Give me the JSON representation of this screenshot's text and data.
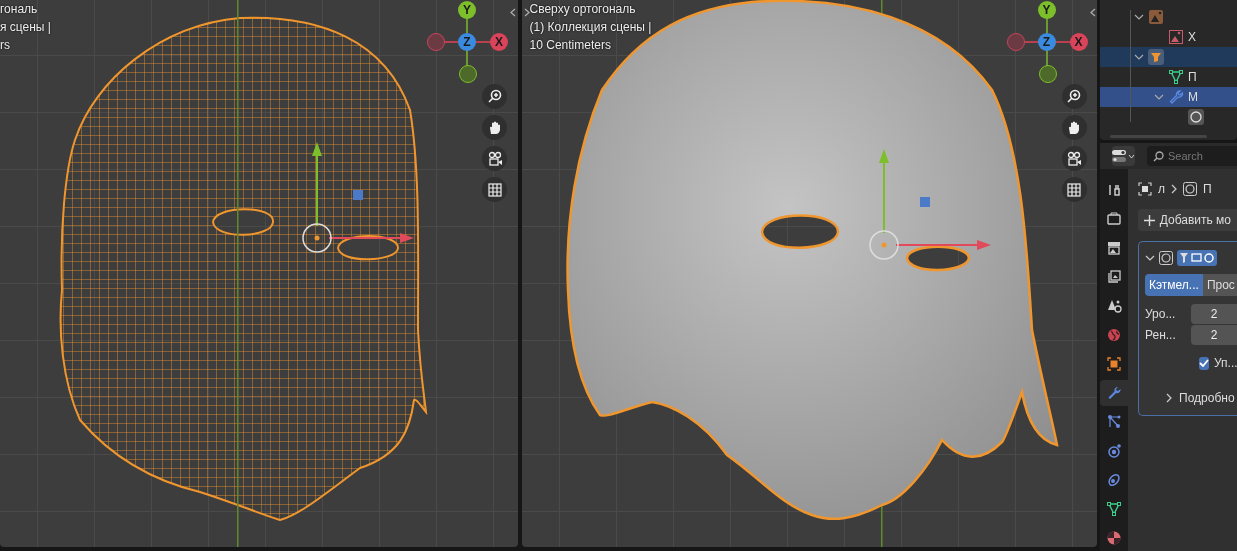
{
  "viewports": [
    {
      "kind": "wireframe",
      "header_lines": [
        "гональ",
        "я сцены |",
        "rs"
      ],
      "gizmo_labels": [
        "Y",
        "Z",
        "X"
      ]
    },
    {
      "kind": "solid",
      "header_lines": [
        "Сверху ортогональ",
        "(1) Коллекция сцены |",
        "10 Centimeters"
      ],
      "gizmo_labels": [
        "Y",
        "Z",
        "X"
      ]
    }
  ],
  "outliner": {
    "items": [
      {
        "kind": "empty",
        "expanded": true,
        "selected": false,
        "active": false,
        "children": [
          {
            "kind": "image",
            "label": "Х",
            "selected": false,
            "active": false
          }
        ]
      },
      {
        "kind": "mesh_object",
        "expanded": true,
        "selected": true,
        "active": false,
        "children": [
          {
            "kind": "mesh_data",
            "label": "П",
            "selected": false,
            "active": false
          },
          {
            "kind": "modifiers",
            "label": "М",
            "expanded": true,
            "selected": true,
            "active": true,
            "children": [
              {
                "kind": "subsurf",
                "selected": false,
                "active": false
              }
            ]
          }
        ]
      }
    ]
  },
  "properties": {
    "search": {
      "placeholder": "Search"
    },
    "breadcrumb": [
      "л",
      "П"
    ],
    "tabs": [
      {
        "kind": "tool",
        "selected": false
      },
      {
        "kind": "render",
        "selected": false
      },
      {
        "kind": "output",
        "selected": false
      },
      {
        "kind": "view_layer",
        "selected": false
      },
      {
        "kind": "scene",
        "selected": false
      },
      {
        "kind": "world",
        "selected": false
      },
      {
        "kind": "object",
        "selected": false
      },
      {
        "kind": "modifier",
        "selected": true
      },
      {
        "kind": "particles",
        "selected": false
      },
      {
        "kind": "physics",
        "selected": false
      },
      {
        "kind": "constraints",
        "selected": false
      },
      {
        "kind": "data",
        "selected": false
      },
      {
        "kind": "material",
        "selected": false
      }
    ],
    "add_button": "Добавить мо",
    "modifier": {
      "expanded": true,
      "mode_tabs": [
        {
          "label": "Кэтмел...",
          "selected": true
        },
        {
          "label": "Прос",
          "selected": false
        }
      ],
      "fields": [
        {
          "label": "Уро...",
          "value": "2"
        },
        {
          "label": "Рен...",
          "value": "2"
        }
      ],
      "checkbox": {
        "label": "Уп...",
        "checked": true
      },
      "subpanel": {
        "label": "Подробно",
        "expanded": false
      }
    }
  }
}
